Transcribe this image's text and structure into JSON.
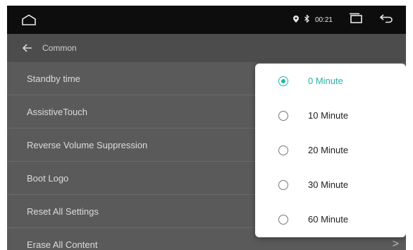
{
  "status_bar": {
    "home_icon": "home-icon",
    "location_icon": "location-icon",
    "bluetooth_icon": "bluetooth-icon",
    "time": "00:21",
    "recents_icon": "recents-icon",
    "back_icon": "back-arrow-icon"
  },
  "header": {
    "title": "Common"
  },
  "settings": [
    {
      "label": "Standby time"
    },
    {
      "label": "AssistiveTouch"
    },
    {
      "label": "Reverse Volume Suppression"
    },
    {
      "label": "Boot Logo"
    },
    {
      "label": "Reset All Settings"
    },
    {
      "label": "Erase All Content",
      "chevron": ">"
    }
  ],
  "dropdown": {
    "selected": "0 Minute",
    "options": [
      {
        "label": "0 Minute",
        "selected": true
      },
      {
        "label": "10 Minute",
        "selected": false
      },
      {
        "label": "20 Minute",
        "selected": false
      },
      {
        "label": "30 Minute",
        "selected": false
      },
      {
        "label": "60 Minute",
        "selected": false
      }
    ]
  },
  "colors": {
    "accent": "#29b3a8",
    "statusbar": "#0d0d0d",
    "header": "#4c4c4c",
    "list_bg": "#5a5a5a"
  }
}
